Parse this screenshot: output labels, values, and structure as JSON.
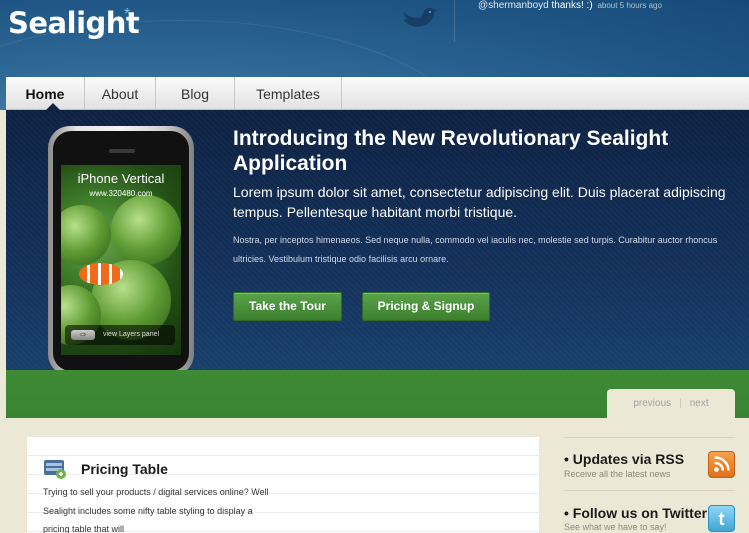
{
  "site": {
    "logo": "Sealight",
    "logo_mark": "*"
  },
  "tweet": {
    "user": "@shermanboyd",
    "message": " thanks! :)",
    "time": "about 5 hours ago"
  },
  "nav": {
    "items": [
      {
        "label": "Home",
        "active": true
      },
      {
        "label": "About"
      },
      {
        "label": "Blog"
      },
      {
        "label": "Templates"
      }
    ]
  },
  "hero": {
    "title": "Introducing the New Revolutionary Sealight Application",
    "lead": "Lorem ipsum dolor sit amet, consectetur adipiscing elit. Duis placerat adipiscing tempus. Pellentesque habitant morbi tristique.",
    "small": "Nostra, per inceptos himenaeos. Sed neque nulla, commodo vel iaculis nec, molestie sed turpis. Curabitur auctor rhoncus ultricies. Vestibulum tristique odio facilisis arcu ornare.",
    "buttons": {
      "tour": "Take the Tour",
      "signup": "Pricing & Signup"
    },
    "phone": {
      "screen_title": "iPhone Vertical",
      "screen_url": "www.320480.com",
      "layers_label": "view Layers panel",
      "layers_arrow": "⇨"
    }
  },
  "pager": {
    "previous": "previous",
    "separator": "|",
    "next": "next"
  },
  "content": {
    "pricing_title": "Pricing Table",
    "pricing_text": "Trying to sell your products / digital services online? Well Sealight includes some nifty table styling to display a pricing table that will"
  },
  "sidebar": {
    "rss_title": "Updates via RSS",
    "rss_sub": "Receive all the latest news",
    "twitter_title": "Follow us on Twitter",
    "twitter_sub": "See what we have to say!",
    "twitter_letter": "t",
    "bullet": "•"
  },
  "colors": {
    "header_blue": "#1f5685",
    "hero_navy": "#0d2142",
    "green": "#3e8a35",
    "button_green": "#4a9340",
    "background": "#ece8d6",
    "rss_orange": "#f08a2a",
    "twitter_blue": "#3fa6d6"
  },
  "icons": {
    "bird": "twitter-bird-icon",
    "rss": "rss-icon",
    "twitter": "twitter-icon",
    "pricing": "pricing-table-icon"
  }
}
